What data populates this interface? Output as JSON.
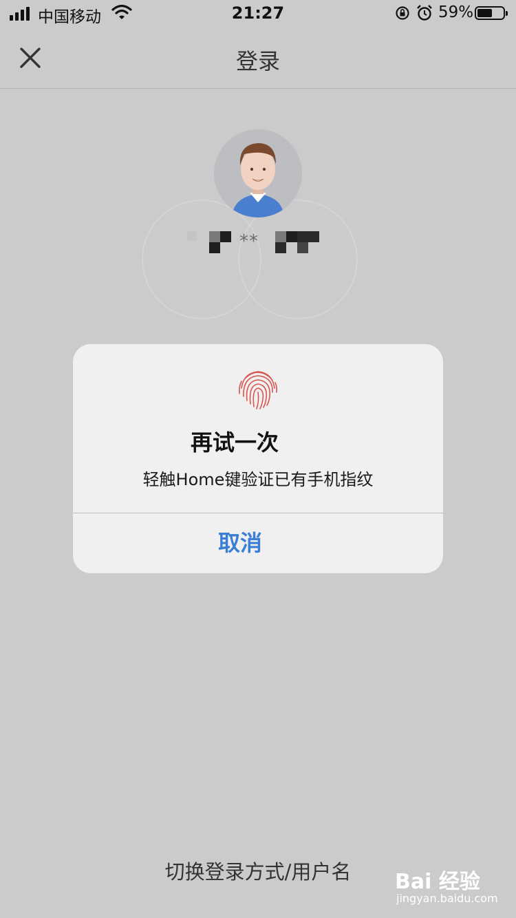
{
  "status_bar": {
    "carrier": "中国移动",
    "time": "21:27",
    "battery_percent": "59%",
    "battery_level": 0.59,
    "icons": [
      "signal-icon",
      "wifi-icon",
      "rotation-lock-icon",
      "alarm-icon",
      "battery-icon"
    ]
  },
  "navbar": {
    "title": "登录",
    "close_icon": "close-icon"
  },
  "profile": {
    "avatar_icon": "avatar-icon",
    "username_masked": "**"
  },
  "dialog": {
    "icon": "fingerprint-icon",
    "title": "再试一次",
    "message": "轻触Home键验证已有手机指纹",
    "cancel_label": "取消",
    "accent_color": "#3b7fd4",
    "icon_color": "#d9534f"
  },
  "footer": {
    "switch_login": "切换登录方式/用户名"
  },
  "watermark": {
    "logo": "Bai 经验",
    "url": "jingyan.baidu.com"
  }
}
